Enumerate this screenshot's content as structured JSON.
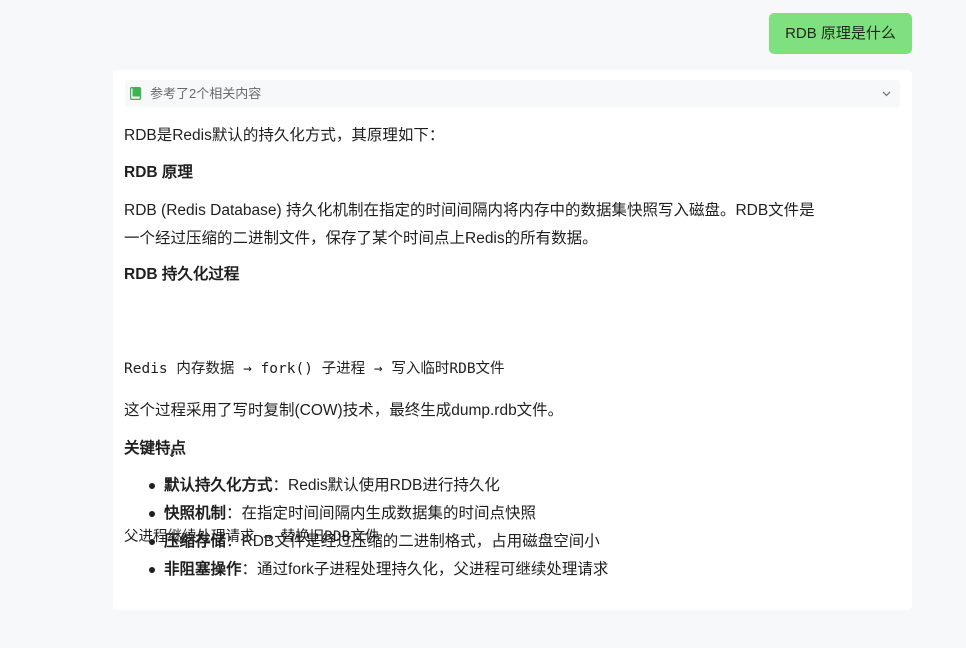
{
  "user_message": "RDB 原理是什么",
  "references": {
    "label": "参考了2个相关内容",
    "icon": "book-icon",
    "toggle_icon": "chevron-down-icon",
    "icon_color": "#3fb34f"
  },
  "answer": {
    "intro": "RDB是Redis默认的持久化方式，其原理如下：",
    "section1_title": "RDB 原理",
    "section1_line1": "RDB (Redis Database) 持久化机制在指定的时间间隔内将内存中的数据集快照写入磁盘。RDB文件是",
    "section1_line2": "一个经过压缩的二进制文件，保存了某个时间点上Redis的所有数据。",
    "section2_title": "RDB 持久化过程",
    "code_line1": "Redis 内存数据 → fork() 子进程 → 写入临时RDB文件",
    "code_line2": "     ↓",
    "code_line3": "父进程继续处理请求 → 替换旧RDB文件",
    "cow_note": "这个过程采用了写时复制(COW)技术，最终生成dump.rdb文件。",
    "section3_title": "关键特点",
    "features": [
      {
        "name": "默认持久化方式",
        "sep": "：",
        "desc": "Redis默认使用RDB进行持久化"
      },
      {
        "name": "快照机制",
        "sep": "：",
        "desc": "在指定时间间隔内生成数据集的时间点快照"
      },
      {
        "name": "压缩存储",
        "sep": "：",
        "desc": "RDB文件是经过压缩的二进制格式，占用磁盘空间小"
      },
      {
        "name": "非阻塞操作",
        "sep": "：",
        "desc": "通过fork子进程处理持久化，父进程可继续处理请求"
      }
    ]
  },
  "colors": {
    "user_bubble": "#7ee07e",
    "page_bg": "#f7f8fa",
    "card_bg": "#ffffff"
  }
}
